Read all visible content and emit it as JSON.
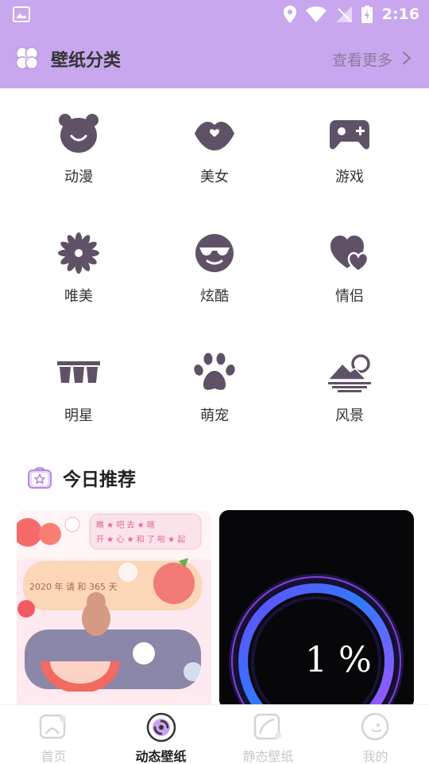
{
  "status_bar": {
    "time": "2:16"
  },
  "header": {
    "title": "壁纸分类",
    "more_label": "查看更多"
  },
  "categories": [
    {
      "label": "动漫",
      "icon": "bear-icon"
    },
    {
      "label": "美女",
      "icon": "lips-icon"
    },
    {
      "label": "游戏",
      "icon": "gamepad-icon"
    },
    {
      "label": "唯美",
      "icon": "flower-icon"
    },
    {
      "label": "炫酷",
      "icon": "sunglasses-face-icon"
    },
    {
      "label": "情侣",
      "icon": "hearts-icon"
    },
    {
      "label": "明星",
      "icon": "stage-icon"
    },
    {
      "label": "萌宠",
      "icon": "paw-icon"
    },
    {
      "label": "风景",
      "icon": "landscape-icon"
    }
  ],
  "section": {
    "title": "今日推荐"
  },
  "recommend": {
    "left_card": {
      "line1": "瞧 ★ 吧 去 ★ 瞎",
      "line2": "开 ★ 心 ★ 和 了 啦 ★ 起",
      "banner": "2020 年 请 和 365 天"
    },
    "right_card": {
      "progress_text": "1 %"
    }
  },
  "tabs": [
    {
      "label": "首页",
      "icon": "home-icon",
      "active": false
    },
    {
      "label": "动态壁纸",
      "icon": "disc-icon",
      "active": true
    },
    {
      "label": "静态壁纸",
      "icon": "image-icon",
      "active": false
    },
    {
      "label": "我的",
      "icon": "profile-icon",
      "active": false
    }
  ],
  "colors": {
    "header_bg": "#c8a7ee",
    "icon": "#5f5266",
    "accent": "#b38ae6"
  }
}
